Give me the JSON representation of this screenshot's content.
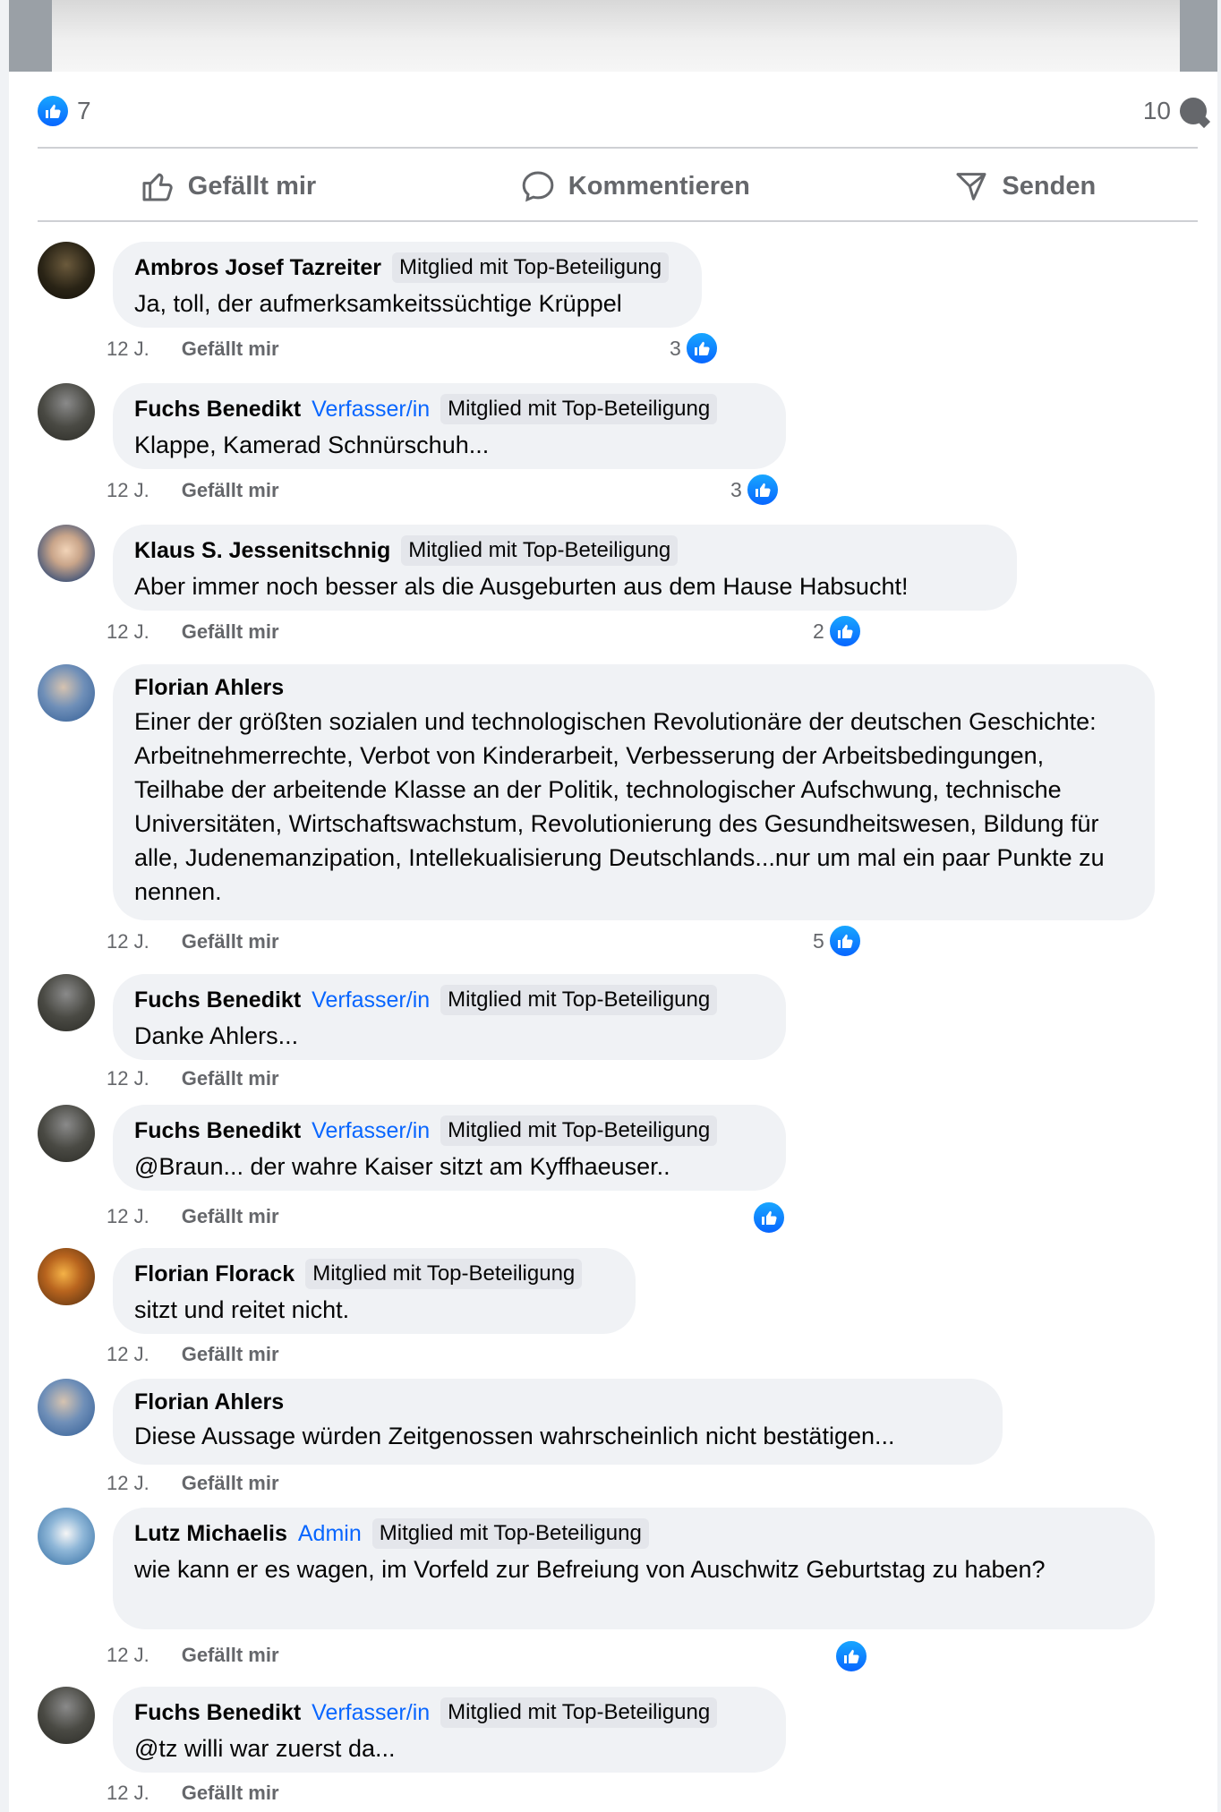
{
  "post": {
    "like_count": "7",
    "comment_count": "10"
  },
  "actions": {
    "like": "Gefällt mir",
    "comment": "Kommentieren",
    "send": "Senden"
  },
  "comments": [
    {
      "author": "Ambros Josef Tazreiter",
      "role": "",
      "badge": "Mitglied mit Top-Beteiligung",
      "text": "Ja, toll, der aufmerksamkeitssüchtige Krüppel",
      "time": "12 J.",
      "like_label": "Gefällt mir",
      "reactions": "3"
    },
    {
      "author": "Fuchs Benedikt",
      "role": "Verfasser/in",
      "badge": "Mitglied mit Top-Beteiligung",
      "text": "Klappe, Kamerad Schnürschuh...",
      "time": "12 J.",
      "like_label": "Gefällt mir",
      "reactions": "3"
    },
    {
      "author": "Klaus S. Jessenitschnig",
      "role": "",
      "badge": "Mitglied mit Top-Beteiligung",
      "text": "Aber immer noch besser als die Ausgeburten aus dem Hause Habsucht!",
      "time": "12 J.",
      "like_label": "Gefällt mir",
      "reactions": "2"
    },
    {
      "author": "Florian Ahlers",
      "role": "",
      "badge": "",
      "text": "Einer der größten sozialen und technologischen Revolutionäre der deutschen Geschichte: Arbeitnehmerrechte, Verbot von Kinderarbeit, Verbesserung der Arbeitsbedingungen, Teilhabe der arbeitende Klasse an der Politik, technologischer Aufschwung, technische Universitäten, Wirtschaftswachstum, Revolutionierung des Gesundheitswesen, Bildung für alle, Judenemanzipation, Intellekualisierung Deutschlands...nur um mal ein paar Punkte zu nennen.",
      "time": "12 J.",
      "like_label": "Gefällt mir",
      "reactions": "5"
    },
    {
      "author": "Fuchs Benedikt",
      "role": "Verfasser/in",
      "badge": "Mitglied mit Top-Beteiligung",
      "text": "Danke Ahlers...",
      "time": "12 J.",
      "like_label": "Gefällt mir",
      "reactions": ""
    },
    {
      "author": "Fuchs Benedikt",
      "role": "Verfasser/in",
      "badge": "Mitglied mit Top-Beteiligung",
      "text": "@Braun... der wahre Kaiser sitzt am Kyffhaeuser..",
      "time": "12 J.",
      "like_label": "Gefällt mir",
      "reactions": ""
    },
    {
      "author": "Florian Florack",
      "role": "",
      "badge": "Mitglied mit Top-Beteiligung",
      "text": "sitzt und reitet nicht.",
      "time": "12 J.",
      "like_label": "Gefällt mir",
      "reactions": ""
    },
    {
      "author": "Florian Ahlers",
      "role": "",
      "badge": "",
      "text": "Diese Aussage würden Zeitgenossen wahrscheinlich nicht bestätigen...",
      "time": "12 J.",
      "like_label": "Gefällt mir",
      "reactions": ""
    },
    {
      "author": "Lutz Michaelis",
      "role": "Admin",
      "badge": "Mitglied mit Top-Beteiligung",
      "text": "wie kann er es wagen, im Vorfeld zur Befreiung von Auschwitz Geburtstag zu haben?",
      "time": "12 J.",
      "like_label": "Gefällt mir",
      "reactions": ""
    },
    {
      "author": "Fuchs Benedikt",
      "role": "Verfasser/in",
      "badge": "Mitglied mit Top-Beteiligung",
      "text": "@tz willi war zuerst da...",
      "time": "12 J.",
      "like_label": "Gefällt mir",
      "reactions": ""
    }
  ]
}
